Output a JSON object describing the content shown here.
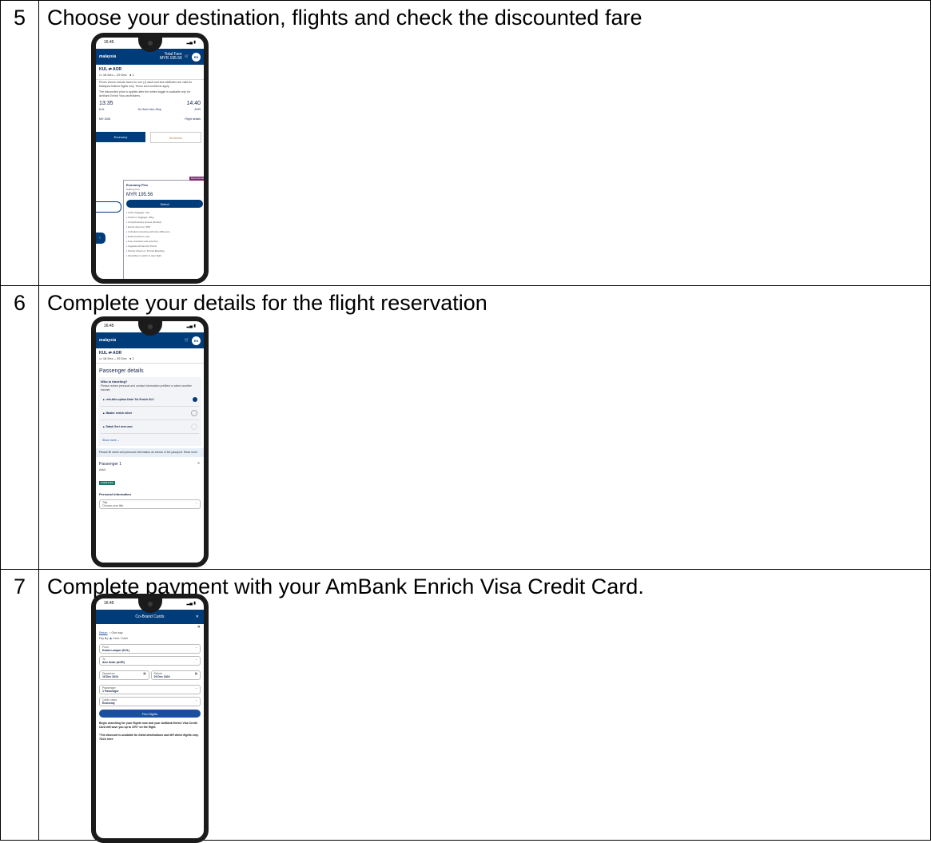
{
  "steps": [
    {
      "number": "5",
      "text": "Choose your destination, flights and check the discounted fare"
    },
    {
      "number": "6",
      "text": "Complete your details for the flight reservation"
    },
    {
      "number": "7",
      "text": "Complete payment with your AmBank Enrich Visa Credit Card."
    }
  ],
  "phone5": {
    "time": "16:45",
    "logo": "malaysia",
    "total_label": "Total Fare",
    "total_value": "MYR 195.56",
    "avatar": "ES",
    "route": "KUL ⇄ AOR",
    "dates": "18 Dec – 29 Dec",
    "pax": "1",
    "notice1": "Prices shown include taxes for one (1) adult and fare attributes are valid for Malaysia Airlines flights only. Terms and conditions apply.",
    "notice2": "The discounted price is applied after the dotted toggle is available only for AmBank Enrich Visa cardholders.",
    "dep_time": "13:35",
    "dep_code": "KUL",
    "arr_time": "14:40",
    "arr_code": "AOR",
    "duration": "1hr 5min Non-Stop",
    "flight_no": "MH 1008",
    "flight_details": "Flight details",
    "tab_economy": "Economy",
    "tab_business": "Business",
    "recommended": "Recommended",
    "fare_name": "Economy Flex",
    "fare_from": "Starting from",
    "fare_price": "MYR 195.56",
    "select": "Select",
    "features": [
      "Cabin baggage: 7kg",
      "Check-in baggage: 30kg",
      "Complimentary access (limited)",
      "Enrich discount: 30%",
      "Unlimited rebooking with fare difference",
      "Refund without a fee",
      "Free standard seat selection",
      "Upgrade with Enrich Points",
      "Priority Check-in, Priority Boarding",
      "Flexibility to switch to later flight"
    ]
  },
  "phone6": {
    "time": "16:45",
    "logo": "malaysia",
    "avatar": "ES",
    "route": "KUL ⇄ AOR",
    "dates": "18 Dec – 29 Dec",
    "pax": "1",
    "heading": "Passenger details",
    "who": "Who is traveling?",
    "who_sub": "Please review personal and contact information prefilled or select another traveler.",
    "passengers": [
      "refx-title-option.Dato' Sri Enrich SLV",
      "Master enrich silver",
      "Datuk Seri new user"
    ],
    "show_more": "Show more",
    "note": "Please fill name and personal information as shown in the passport. Read more",
    "passenger1": "Passenger 1",
    "adult": "Adult",
    "badge": "COMPLETED",
    "personal": "Personal information",
    "title_label": "Title",
    "title_placeholder": "Choose your title"
  },
  "phone7": {
    "time": "16:45",
    "header": "Co-Brand Cards",
    "trip_return": "Return",
    "trip_oneway": "One-way",
    "pay_by": "Pay By:",
    "pay_option": "Card / Cash",
    "from_label": "From",
    "from_value": "Kuala Lumpur (KUL)",
    "to_label": "To",
    "to_value": "Alor Setar (AOR)",
    "dep_label": "Departure",
    "dep_value": "18 Dec 2024",
    "ret_label": "Return",
    "ret_value": "29 Dec 2024",
    "pax_label": "Passenger",
    "pax_value": "1 Passenger",
    "cabin_label": "Cabin class",
    "cabin_value": "Economy",
    "find": "Find flights",
    "para1": "Begin searching for your flights now and your AmBank Enrich Visa Credit Card will save you up to 10%* on the flight.",
    "para2": "*The discount is available for listed destinations and MH direct flights only. T&Cs here"
  }
}
